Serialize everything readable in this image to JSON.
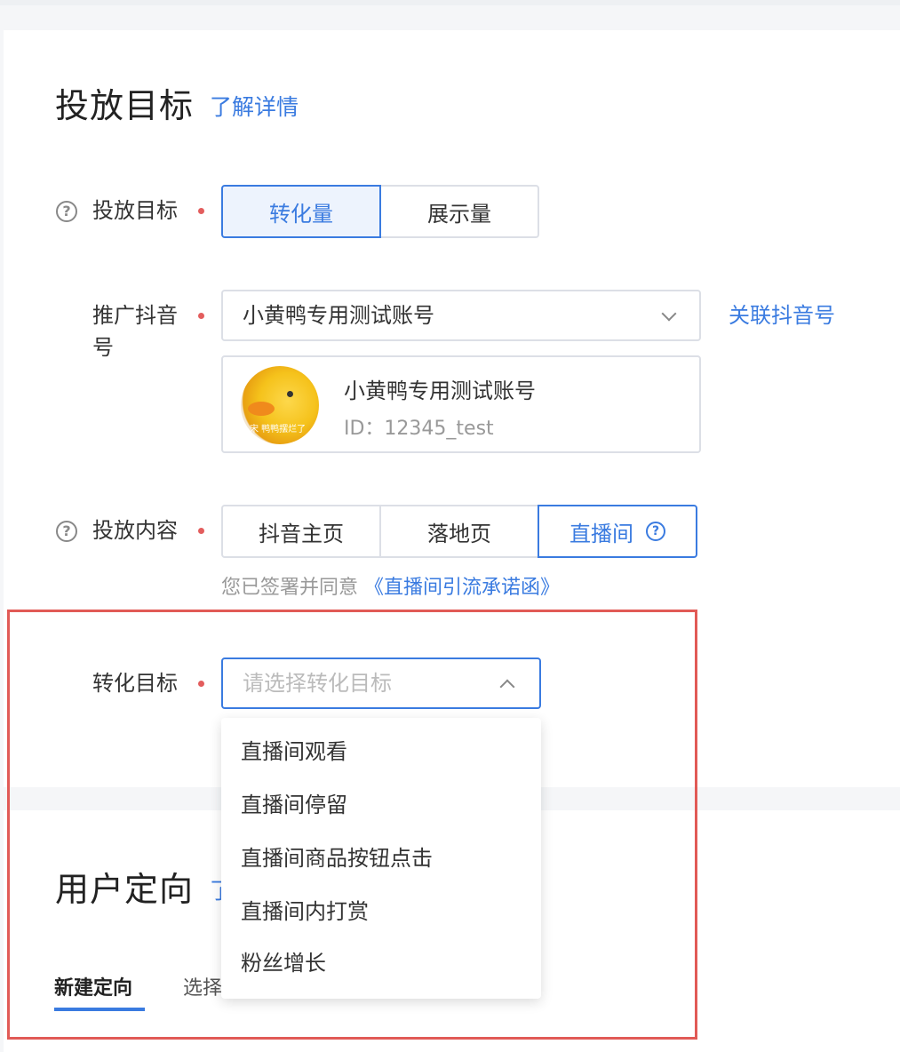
{
  "section1": {
    "title": "投放目标",
    "detail_link": "了解详情"
  },
  "goal": {
    "label": "投放目标",
    "options": [
      "转化量",
      "展示量"
    ],
    "selected": "转化量"
  },
  "account": {
    "label": "推广抖音号",
    "selected": "小黄鸭专用测试账号",
    "link_label": "关联抖音号",
    "card_name": "小黄鸭专用测试账号",
    "card_id": "ID：12345_test",
    "avatar_caption": "宋 鸭鸭摆烂了"
  },
  "content": {
    "label": "投放内容",
    "options": [
      "抖音主页",
      "落地页",
      "直播间"
    ],
    "selected": "直播间",
    "agreement_text": "您已签署并同意",
    "agreement_link": "《直播间引流承诺函》"
  },
  "conversion": {
    "label": "转化目标",
    "placeholder": "请选择转化目标",
    "dropdown_options": [
      "直播间观看",
      "直播间停留",
      "直播间商品按钮点击",
      "直播间内打赏",
      "粉丝增长"
    ]
  },
  "section2": {
    "title": "用户定向",
    "detail_link_partial": "了",
    "tabs": [
      "新建定向",
      "选择"
    ],
    "active_tab": "新建定向"
  },
  "colors": {
    "accent": "#3a7be0",
    "required_dot": "#e35d5d",
    "highlight_border": "#e15a56"
  }
}
